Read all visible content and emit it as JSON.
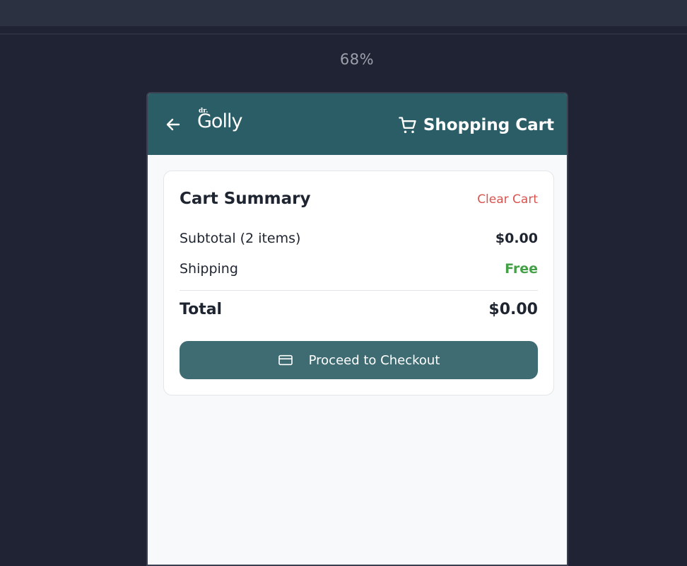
{
  "browser": {
    "zoom_level": "68%"
  },
  "header": {
    "logo_text_small": "dr.",
    "logo_text": "Golly",
    "title": "Shopping Cart"
  },
  "summary": {
    "title": "Cart Summary",
    "clear_label": "Clear Cart",
    "subtotal_label": "Subtotal (2 items)",
    "subtotal_value": "$0.00",
    "shipping_label": "Shipping",
    "shipping_value": "Free",
    "total_label": "Total",
    "total_value": "$0.00",
    "checkout_label": "Proceed to Checkout"
  },
  "colors": {
    "header_bg": "#2b5d66",
    "button_bg": "#3f6c73",
    "danger": "#d9534f",
    "success": "#43a047"
  },
  "icons": [
    "arrow-left-icon",
    "cart-icon",
    "credit-card-icon"
  ]
}
